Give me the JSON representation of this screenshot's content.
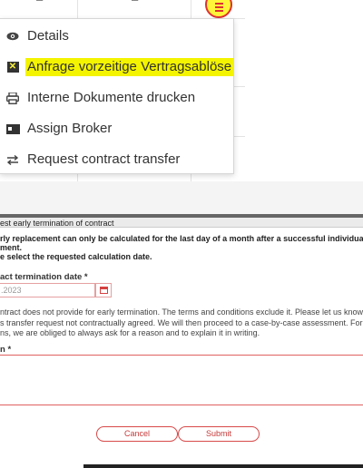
{
  "table": {
    "stub_left": "–",
    "stub_mid": "–"
  },
  "menu": {
    "items": [
      {
        "icon": "eye-icon",
        "label": "Details"
      },
      {
        "icon": "x-box-icon",
        "label": "Anfrage vorzeitige Vertragsablöse"
      },
      {
        "icon": "printer-icon",
        "label": "Interne Dokumente drucken"
      },
      {
        "icon": "id-card-icon",
        "label": "Assign Broker"
      },
      {
        "icon": "transfer-arrows-icon",
        "label": "Request contract transfer"
      }
    ],
    "highlight_color": "#f4f400"
  },
  "modal": {
    "title": "est early termination of contract",
    "notice": [
      "rly replacement can only be calculated for the last day of a month after a successful individual",
      "ment.",
      "e select the requested calculation date."
    ],
    "date_label": "act termination date *",
    "date_value": ".2023",
    "info": [
      "ntract does not provide for early termination. The terms and conditions exclude it. Please let us know the r",
      "s transfer request not contractually agreed. We will then proceed to a case-by-case assessment. For regulat",
      "ns, we are obliged to always ask for a reason and to explain it in writing."
    ],
    "reason_label": "n *",
    "reason_value": "",
    "cancel_label": "Cancel",
    "submit_label": "Submit"
  },
  "colors": {
    "accent_red": "#d84a4a",
    "menu_button_fill": "#fff43a"
  }
}
